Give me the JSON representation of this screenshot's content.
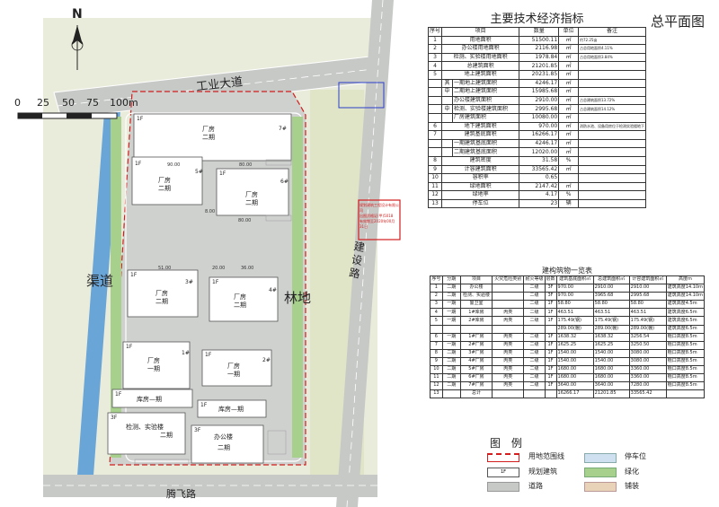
{
  "plan": {
    "roads": {
      "industrial_avenue": "工业大道",
      "tengfei_road": "腾飞路",
      "jianshe_road": "建设路"
    },
    "labels": {
      "canal": "渠道",
      "forest": "林地",
      "north": "N"
    },
    "scale_ticks": [
      "0",
      "25",
      "50",
      "75",
      "100m"
    ],
    "stamp_top": [
      "",
      ""
    ],
    "stamp_side": [
      "规划建筑工程设计有限公司",
      "出图资格证(甲)5018",
      "有效期至2020年00月31日"
    ],
    "buildings": [
      {
        "name": "厂房\n二期",
        "floor": "1F",
        "tag": "7#"
      },
      {
        "name": "厂房\n二期",
        "floor": "1F",
        "tag": "5#"
      },
      {
        "name": "厂房\n二期",
        "floor": "1F",
        "tag": "6#"
      },
      {
        "name": "厂房\n二期",
        "floor": "1F",
        "tag": "3#"
      },
      {
        "name": "厂房\n二期",
        "floor": "1F",
        "tag": "4#"
      },
      {
        "name": "厂房\n一期",
        "floor": "1F",
        "tag": "1#"
      },
      {
        "name": "厂房\n一期",
        "floor": "1F",
        "tag": "2#"
      },
      {
        "name": "库房—期",
        "floor": "1F",
        "tag": "1F"
      },
      {
        "name": "库房—期",
        "floor": "1F",
        "tag": "1F"
      },
      {
        "name": "检测、实验楼",
        "floor": "3F",
        "tag": "二期"
      },
      {
        "name": "办公楼",
        "floor": "3F",
        "tag": "二期"
      }
    ],
    "dims": [
      "90.00",
      "80.00",
      "80.00",
      "20.00",
      "51.00",
      "36.00",
      "8.00"
    ]
  },
  "right": {
    "title": "总平面图",
    "econ_title": "主要技术经济指标",
    "econ_headers": [
      "序号",
      "项目",
      "数量",
      "单位",
      "备注"
    ],
    "econ_rows": [
      {
        "no": "1",
        "item": "用地面积",
        "qty": "51500.11",
        "unit": "㎡",
        "note": "约72.25亩"
      },
      {
        "no": "2",
        "item": "办公楼用地面积",
        "qty": "2116.98",
        "unit": "㎡",
        "note": "占总用地面积4.11%"
      },
      {
        "no": "3",
        "item": "检测、实验楼用地面积",
        "qty": "1978.84",
        "unit": "㎡",
        "note": "占总用地面积3.84%"
      },
      {
        "no": "4",
        "item": "总建筑面积",
        "qty": "21201.85",
        "unit": "㎡",
        "note": ""
      },
      {
        "no": "5",
        "item": "地上建筑面积",
        "qty": "20231.85",
        "unit": "㎡",
        "note": ""
      },
      {
        "no": "",
        "item": "一期地上建筑面积",
        "qty": "4246.17",
        "unit": "㎡",
        "note": ""
      },
      {
        "no": "",
        "item": "二期地上建筑面积",
        "qty": "15985.68",
        "unit": "㎡",
        "note": ""
      },
      {
        "no": "",
        "item": "办公楼建筑面积",
        "qty": "2910.00",
        "unit": "㎡",
        "note": "占总建筑面积13.72%"
      },
      {
        "no": "",
        "item": "检测、实验楼建筑面积",
        "qty": "2995.68",
        "unit": "㎡",
        "note": "占总建筑面积14.12%"
      },
      {
        "no": "",
        "item": "厂房建筑面积",
        "qty": "10080.00",
        "unit": "㎡",
        "note": ""
      },
      {
        "no": "6",
        "item": "地下建筑面积",
        "qty": "970.00",
        "unit": "㎡",
        "note": "消防水池、设备用房位于检测实验楼地下"
      },
      {
        "no": "7",
        "item": "建筑基底面积",
        "qty": "16266.17",
        "unit": "㎡",
        "note": ""
      },
      {
        "no": "",
        "item": "一期建筑基底面积",
        "qty": "4246.17",
        "unit": "㎡",
        "note": ""
      },
      {
        "no": "",
        "item": "二期建筑基底面积",
        "qty": "12020.00",
        "unit": "㎡",
        "note": ""
      },
      {
        "no": "8",
        "item": "建筑密度",
        "qty": "31.58",
        "unit": "%",
        "note": ""
      },
      {
        "no": "9",
        "item": "计容建筑面积",
        "qty": "33565.42",
        "unit": "㎡",
        "note": ""
      },
      {
        "no": "10",
        "item": "容积率",
        "qty": "0.65",
        "unit": "",
        "note": ""
      },
      {
        "no": "11",
        "item": "绿地面积",
        "qty": "2147.42",
        "unit": "㎡",
        "note": ""
      },
      {
        "no": "12",
        "item": "绿地率",
        "qty": "4.17",
        "unit": "%",
        "note": ""
      },
      {
        "no": "13",
        "item": "停车位",
        "qty": "23",
        "unit": "辆",
        "note": ""
      }
    ],
    "econ_side": [
      "其",
      "中",
      "其",
      "中"
    ],
    "build_title": "建构筑物一览表",
    "build_headers": [
      "序号",
      "分期",
      "项目",
      "火灾危险类别",
      "耐火等级",
      "层数",
      "建筑基底面积㎡",
      "总建筑面积㎡",
      "计容建筑面积㎡",
      "高度m"
    ],
    "build_rows": [
      [
        "1",
        "二期",
        "办公楼",
        "",
        "二级",
        "3F",
        "970.00",
        "2910.00",
        "2910.00",
        "建筑高度14.10m"
      ],
      [
        "2",
        "二期",
        "检测、实验楼",
        "",
        "二级",
        "3F",
        "970.00",
        "3965.68",
        "2995.68",
        "建筑高度14.10m"
      ],
      [
        "3",
        "一期",
        "警卫室",
        "",
        "二级",
        "1F",
        "58.80",
        "58.80",
        "58.80",
        "建筑高度4.5m"
      ],
      [
        "4",
        "一期",
        "1#库房",
        "丙类",
        "二级",
        "1F",
        "463.51",
        "463.51",
        "463.51",
        "建筑高度6.5m"
      ],
      [
        "5",
        "一期",
        "2#库房",
        "丙类",
        "二级",
        "1F",
        "175.49(钢)",
        "175.49(钢)",
        "175.49(钢)",
        "建筑高度6.5m"
      ],
      [
        "",
        "",
        "",
        "",
        "",
        "",
        "289.00(棚)",
        "289.00(棚)",
        "289.00(棚)",
        "建筑高度6.5m"
      ],
      [
        "6",
        "一期",
        "1#厂房",
        "丙类",
        "二级",
        "1F",
        "1638.32",
        "1638.32",
        "3256.54",
        "檐口高度8.5m"
      ],
      [
        "7",
        "一期",
        "2#厂房",
        "丙类",
        "二级",
        "1F",
        "1625.25",
        "1625.25",
        "3250.50",
        "檐口高度8.5m"
      ],
      [
        "8",
        "二期",
        "3#厂房",
        "丙类",
        "二级",
        "1F",
        "1540.00",
        "1540.00",
        "3080.00",
        "檐口高度8.5m"
      ],
      [
        "9",
        "二期",
        "4#厂房",
        "丙类",
        "二级",
        "1F",
        "1540.00",
        "1540.00",
        "3080.00",
        "檐口高度8.5m"
      ],
      [
        "10",
        "二期",
        "5#厂房",
        "丙类",
        "二级",
        "1F",
        "1680.00",
        "1680.00",
        "3360.00",
        "檐口高度8.5m"
      ],
      [
        "11",
        "二期",
        "6#厂房",
        "丙类",
        "二级",
        "1F",
        "1680.00",
        "1680.00",
        "3360.00",
        "檐口高度8.5m"
      ],
      [
        "12",
        "二期",
        "7#厂房",
        "丙类",
        "二级",
        "1F",
        "3640.00",
        "3640.00",
        "7280.00",
        "檐口高度8.5m"
      ],
      [
        "13",
        "",
        "总计",
        "",
        "",
        "",
        "16266.17",
        "21201.85",
        "33565.42",
        ""
      ]
    ],
    "legend_title": "图 例",
    "legend": {
      "boundary": "用地范围线",
      "parking": "停车位",
      "planned": "规划建筑",
      "green": "绿化",
      "road": "道路",
      "paving": "铺装",
      "planned_tag": "1F"
    }
  }
}
